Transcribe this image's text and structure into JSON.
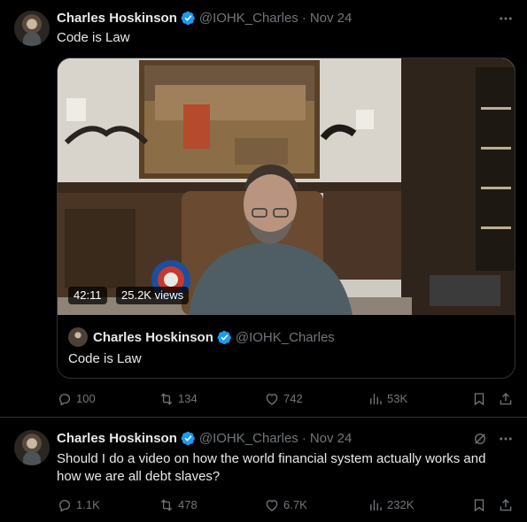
{
  "tweets": [
    {
      "author": "Charles Hoskinson",
      "handle": "@IOHK_Charles",
      "separator": "·",
      "date": "Nov 24",
      "text": "Code is Law",
      "media": {
        "duration": "42:11",
        "views": "25.2K views"
      },
      "quote": {
        "author": "Charles Hoskinson",
        "handle": "@IOHK_Charles",
        "text": "Code is Law"
      },
      "stats": {
        "replies": "100",
        "reposts": "134",
        "likes": "742",
        "views": "53K"
      }
    },
    {
      "author": "Charles Hoskinson",
      "handle": "@IOHK_Charles",
      "separator": "·",
      "date": "Nov 24",
      "text": "Should I do a video on how the world financial system actually works and how we are all debt slaves?",
      "stats": {
        "replies": "1.1K",
        "reposts": "478",
        "likes": "6.7K",
        "views": "232K"
      }
    }
  ],
  "colors": {
    "background": "#000000",
    "text": "#e7e9ea",
    "muted": "#71767b",
    "verified": "#1d9bf0",
    "divider": "#2f3336"
  },
  "icons": [
    "reply-icon",
    "repost-icon",
    "like-icon",
    "views-icon",
    "bookmark-icon",
    "share-icon",
    "more-icon",
    "verified-icon",
    "grok-icon"
  ]
}
